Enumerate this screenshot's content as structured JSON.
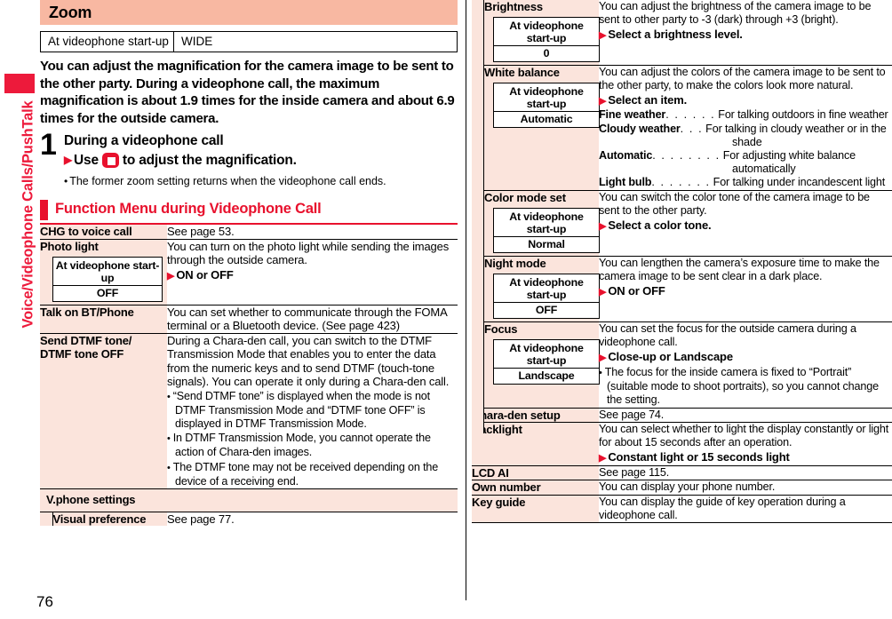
{
  "sidebar": {
    "tab_label": "Voice/Videophone Calls/PushTalk"
  },
  "page_number": "76",
  "left": {
    "title": "Zoom",
    "setting_box": {
      "key": "At videophone start-up",
      "value": "WIDE"
    },
    "lead": "You can adjust the magnification for the camera image to be sent to the other party. During a videophone call, the maximum magnification is about 1.9 times for the inside camera and about 6.9 times for the outside camera.",
    "step": {
      "number": "1",
      "line1": "During a videophone call",
      "line2_pre": "Use",
      "line2_post": "to adjust the magnification.",
      "note": "The former zoom setting returns when the videophone call ends."
    },
    "section_heading": "Function Menu during Videophone Call",
    "rows": [
      {
        "key": "CHG to voice call",
        "desc": "See page 53."
      },
      {
        "key": "Photo light",
        "mini": {
          "label": "At videophone start-up",
          "value": "OFF"
        },
        "desc": "You can turn on the photo light while sending the images through the outside camera.",
        "arrow": "ON or OFF"
      },
      {
        "key": "Talk on BT/Phone",
        "desc": "You can set whether to communicate through the FOMA terminal or a Bluetooth device. (See page 423)"
      },
      {
        "key": "Send DTMF tone/ DTMF tone OFF",
        "key_line1": "Send DTMF tone/",
        "key_line2": "DTMF tone OFF",
        "desc": "During a Chara-den call, you can switch to the DTMF Transmission Mode that enables you to enter the data from the numeric keys and to send DTMF (touch-tone signals). You can operate it only during a Chara-den call.",
        "dots": [
          "“Send DTMF tone” is displayed when the mode is not DTMF Transmission Mode and “DTMF tone OFF” is displayed in DTMF Transmission Mode.",
          "In DTMF Transmission Mode, you cannot operate the action of Chara-den images.",
          "The DTMF tone may not be received depending on the device of a receiving end."
        ]
      }
    ],
    "group": {
      "head": "V.phone settings",
      "rows": [
        {
          "key": "Visual preference",
          "desc": "See page 77."
        }
      ]
    }
  },
  "right": {
    "nested_rows": [
      {
        "key": "Brightness",
        "mini": {
          "label": "At videophone start-up",
          "value": "0"
        },
        "desc": "You can adjust the brightness of the camera image to be sent to other party to -3 (dark) through +3 (bright).",
        "arrow": "Select a brightness level."
      },
      {
        "key": "White balance",
        "mini": {
          "label": "At videophone start-up",
          "value": "Automatic"
        },
        "desc": "You can adjust the colors of the camera image to be sent to the other party, to make the colors look more natural.",
        "arrow": "Select an item.",
        "leaders": [
          {
            "key": "Fine weather",
            "dots": ". . . . . .",
            "value": "For talking outdoors in fine weather"
          },
          {
            "key": "Cloudy weather ",
            "dots": ". . .",
            "value": "For talking in cloudy weather or in the",
            "cont": "shade"
          },
          {
            "key": "Automatic",
            "dots": ". . . . . . . .",
            "value": "For adjusting white balance",
            "cont": "automatically"
          },
          {
            "key": "Light bulb ",
            "dots": ". . . . . . .",
            "value": "For talking under incandescent light"
          }
        ]
      },
      {
        "key": "Color mode set",
        "mini": {
          "label": "At videophone start-up",
          "value": "Normal"
        },
        "desc": "You can switch the color tone of the camera image to be sent to the other party.",
        "arrow": "Select a color tone."
      },
      {
        "key": "Night mode",
        "mini": {
          "label": "At videophone start-up",
          "value": "OFF"
        },
        "desc": "You can lengthen the camera’s exposure time to make the camera image to be sent clear in a dark place.",
        "arrow": "ON or OFF"
      },
      {
        "key": "Focus",
        "mini": {
          "label": "At videophone start-up",
          "value": "Landscape"
        },
        "desc": "You can set the focus for the outside camera during a videophone call.",
        "arrow": "Close-up or Landscape",
        "dots": [
          "The focus for the inside camera is fixed to “Portrait” (suitable mode to shoot portraits), so you cannot change the setting."
        ]
      }
    ],
    "rows": [
      {
        "key": "Chara-den setup",
        "desc": "See page 74."
      },
      {
        "key": "Backlight",
        "desc": "You can select whether to light the display constantly or light for about 15 seconds after an operation.",
        "arrow": "Constant light or 15 seconds light"
      },
      {
        "key": "LCD AI",
        "desc": "See page 115."
      },
      {
        "key": "Own number",
        "desc": "You can display your phone number."
      },
      {
        "key": "Key guide",
        "desc": "You can display the guide of key operation during a videophone call."
      }
    ]
  },
  "colors": {
    "accent_red": "#E8112D",
    "band": "#F8B8A2",
    "cell": "#FBE4DC"
  }
}
